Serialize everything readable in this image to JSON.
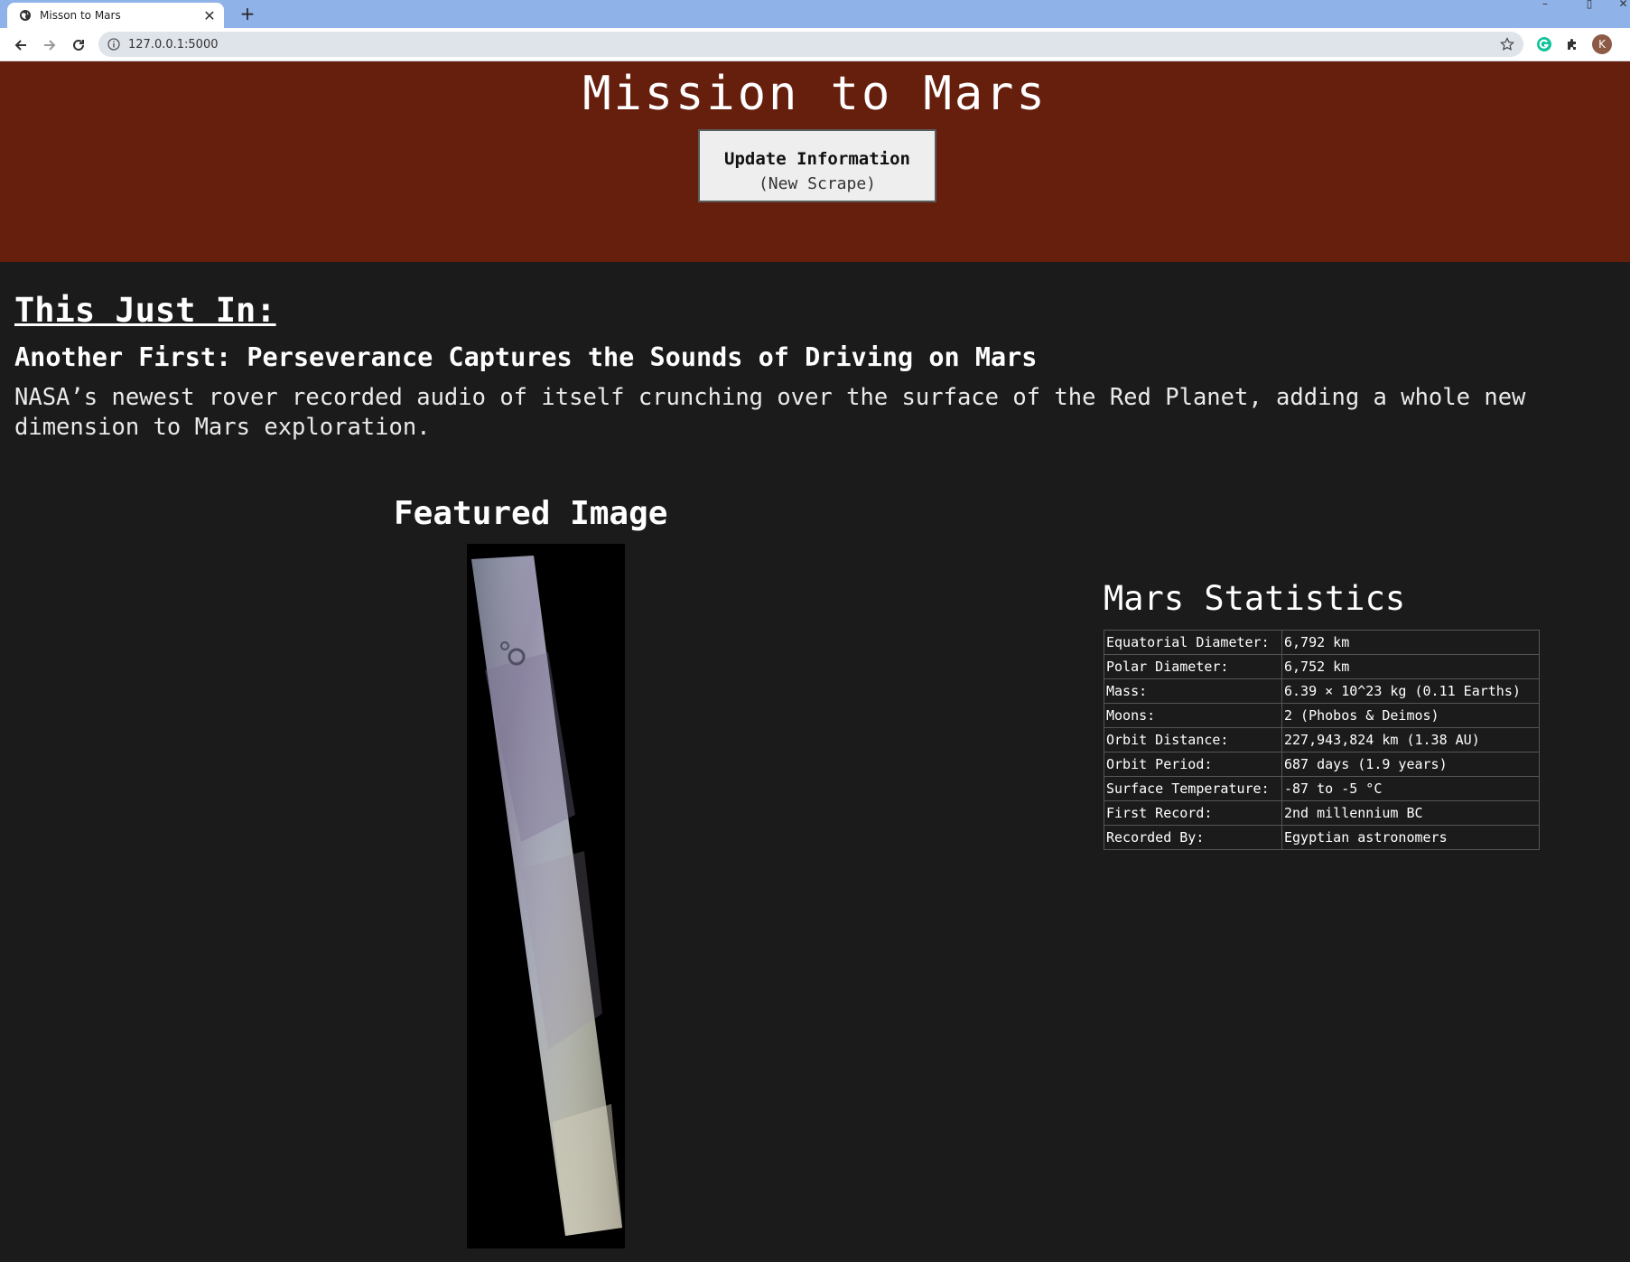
{
  "browser": {
    "tab_title": "Misson to Mars",
    "url": "127.0.0.1:5000",
    "profile_initial": "K"
  },
  "header": {
    "title": "Mission to Mars",
    "button_line1": "Update Information",
    "button_line2": "(New Scrape)",
    "background_color": "#661e0d"
  },
  "news": {
    "heading": "This Just In:",
    "title": "Another First: Perseverance Captures the Sounds of Driving on Mars",
    "paragraph": "NASA’s newest rover recorded audio of itself crunching over the surface of the Red Planet, adding a whole new dimension to Mars exploration."
  },
  "featured": {
    "heading": "Featured Image"
  },
  "stats": {
    "heading": "Mars Statistics",
    "rows": [
      [
        "Equatorial Diameter:",
        "6,792 km"
      ],
      [
        "Polar Diameter:",
        "6,752 km"
      ],
      [
        "Mass:",
        "6.39 × 10^23 kg (0.11 Earths)"
      ],
      [
        "Moons:",
        "2 (Phobos & Deimos)"
      ],
      [
        "Orbit Distance:",
        "227,943,824 km (1.38 AU)"
      ],
      [
        "Orbit Period:",
        "687 days (1.9 years)"
      ],
      [
        "Surface Temperature:",
        "-87 to -5 °C"
      ],
      [
        "First Record:",
        "2nd millennium BC"
      ],
      [
        "Recorded By:",
        "Egyptian astronomers"
      ]
    ]
  }
}
